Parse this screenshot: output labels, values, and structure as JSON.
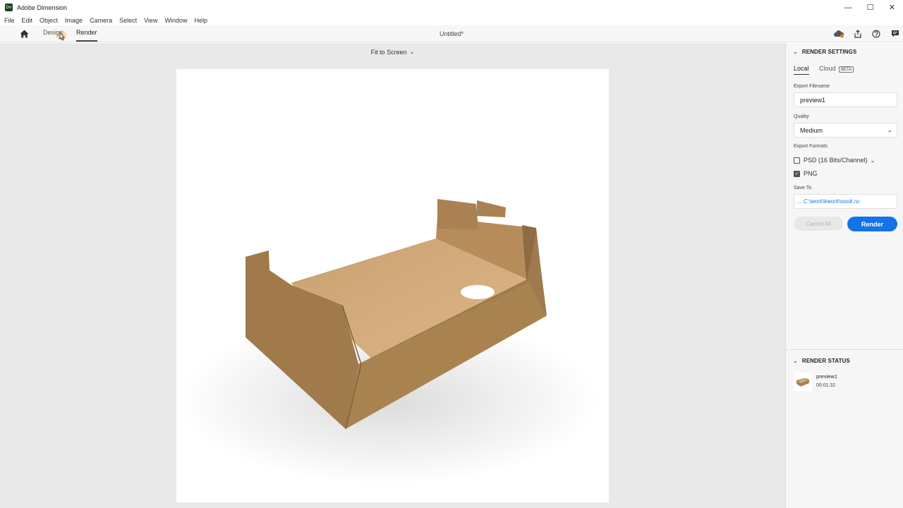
{
  "app": {
    "title": "Adobe Dimension",
    "logo_text": "Dn"
  },
  "window_controls": {
    "minimize": "—",
    "maximize": "☐",
    "close": "✕"
  },
  "menu": [
    "File",
    "Edit",
    "Object",
    "Image",
    "Camera",
    "Select",
    "View",
    "Window",
    "Help"
  ],
  "toolbar": {
    "design_tab": "Design",
    "render_tab": "Render",
    "document_title": "Untitled*",
    "active_tab": "Render"
  },
  "viewport": {
    "zoom_label": "Fit to Screen"
  },
  "render_settings": {
    "header": "RENDER SETTINGS",
    "tabs": {
      "local": "Local",
      "cloud": "Cloud",
      "beta": "BETA"
    },
    "export_filename_label": "Export Filename",
    "export_filename": "preview1",
    "quality_label": "Quality",
    "quality": "Medium",
    "export_formats_label": "Export Formats",
    "formats": [
      {
        "label": "PSD (16 Bits/Channel)",
        "checked": false
      },
      {
        "label": "PNG",
        "checked": true
      }
    ],
    "save_to_label": "Save To",
    "save_to": "... C:\\work\\kwork\\oook.ru",
    "cancel_all": "Cancel All",
    "render": "Render"
  },
  "render_status": {
    "header": "RENDER STATUS",
    "item_name": "preview1",
    "item_time": "00:01:32"
  },
  "colors": {
    "accent": "#1473e6",
    "box": "#c29a68",
    "box_dark": "#8f6d44"
  }
}
